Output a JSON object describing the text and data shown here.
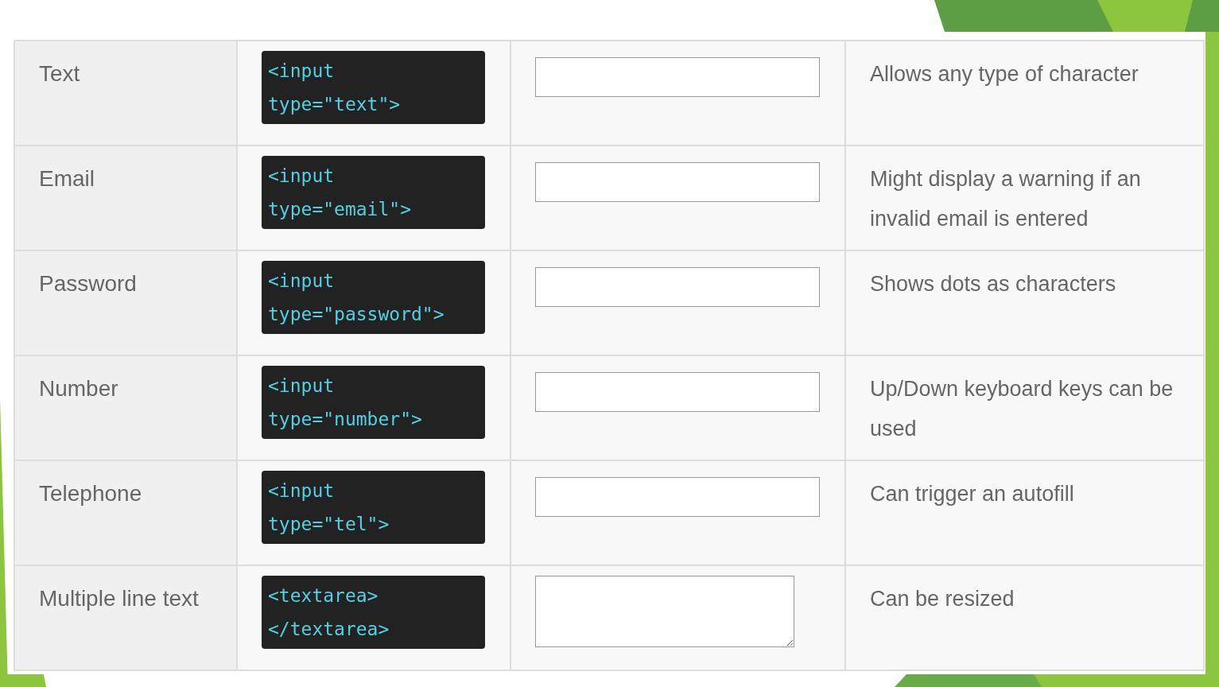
{
  "rows": [
    {
      "label": "Text",
      "code_lines": [
        "<input",
        "type=\"text\">"
      ],
      "kind": "input",
      "description": "Allows any type of character"
    },
    {
      "label": "Email",
      "code_lines": [
        "<input",
        "type=\"email\">"
      ],
      "kind": "input",
      "description": "Might display a warning if an invalid email is entered"
    },
    {
      "label": "Password",
      "code_lines": [
        "<input",
        "type=\"password\">"
      ],
      "kind": "input",
      "description": "Shows dots as characters"
    },
    {
      "label": "Number",
      "code_lines": [
        "<input",
        "type=\"number\">"
      ],
      "kind": "input",
      "description": "Up/Down keyboard keys can be used"
    },
    {
      "label": "Telephone",
      "code_lines": [
        "<input",
        "type=\"tel\">"
      ],
      "kind": "input",
      "description": "Can trigger an autofill"
    },
    {
      "label": "Multiple line text",
      "code_lines": [
        "<textarea>",
        "</textarea>"
      ],
      "kind": "textarea",
      "description": "Can be resized"
    }
  ]
}
